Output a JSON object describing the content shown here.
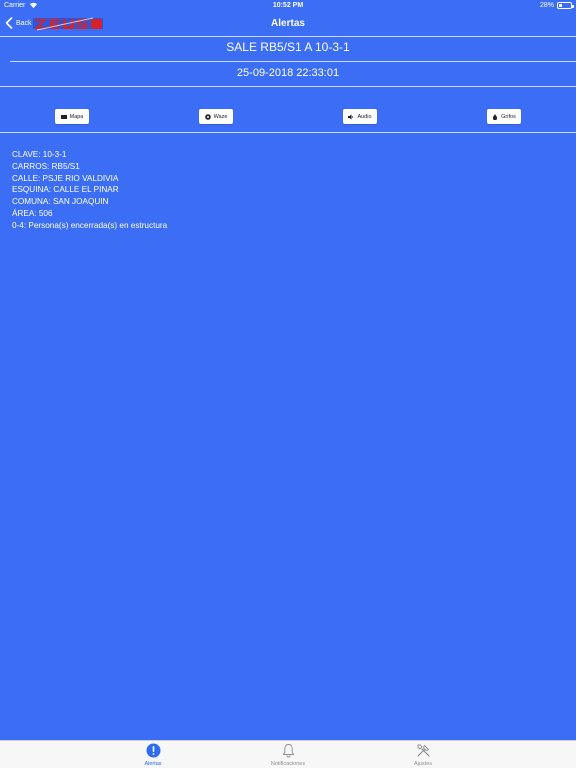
{
  "status_bar": {
    "carrier": "Carrier",
    "time": "10:52 PM",
    "battery": "28%"
  },
  "nav": {
    "back_label": "Back",
    "title": "Alertas"
  },
  "alert": {
    "title": "SALE RB5/S1 A 10-3-1",
    "datetime": "25-09-2018 22:33:01"
  },
  "actions": [
    {
      "label": "Mapa",
      "icon": "map-icon"
    },
    {
      "label": "Waze",
      "icon": "waze-icon"
    },
    {
      "label": "Audio",
      "icon": "speaker-icon"
    },
    {
      "label": "Grifos",
      "icon": "water-drop-icon"
    }
  ],
  "details": [
    "CLAVE: 10-3-1",
    "CARROS: RB5/S1",
    "CALLE: PSJE RIO VALDIVIA",
    "ESQUINA: CALLE EL PINAR",
    "COMUNA: SAN JOAQUIN",
    "ÁREA: 506",
    "0-4: Persona(s) encerrada(s) en estructura"
  ],
  "tabs": [
    {
      "label": "Alertas",
      "icon": "exclamation-circle-icon",
      "active": true
    },
    {
      "label": "Notificaciones",
      "icon": "bell-icon",
      "active": false
    },
    {
      "label": "Ajustes",
      "icon": "tools-icon",
      "active": false
    }
  ],
  "colors": {
    "background": "#3b6ef5",
    "tab_active": "#2f6bf0",
    "tab_inactive": "#8e8e93",
    "logo_red": "#d8202a"
  }
}
